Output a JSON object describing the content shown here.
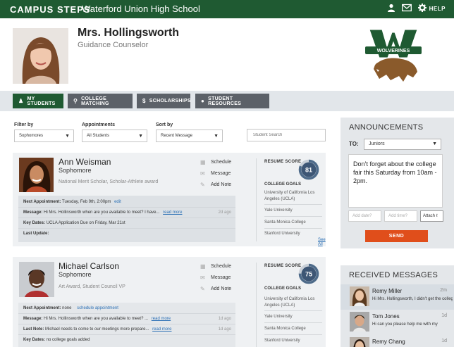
{
  "header": {
    "brand": "CAMPUS STEPS",
    "school": "Waterford Union High School",
    "help": "HELP"
  },
  "profile": {
    "name": "Mrs. Hollingsworth",
    "role": "Guidance Counselor"
  },
  "logo": {
    "text": "WOLVERINES"
  },
  "tabs": [
    {
      "label": "MY STUDENTS",
      "icon": "students-icon"
    },
    {
      "label": "COLLEGE MATCHING",
      "icon": "search-icon"
    },
    {
      "label": "SCHOLARSHIPS",
      "icon": "dollar-icon"
    },
    {
      "label": "STUDENT RESOURCES",
      "icon": "apple-icon"
    }
  ],
  "filters": {
    "filter_by": {
      "label": "Filter by",
      "value": "Sophomores"
    },
    "appointments": {
      "label": "Appointments",
      "value": "All Students"
    },
    "sort_by": {
      "label": "Sort by",
      "value": "Recent Message"
    },
    "search_placeholder": "Student Search"
  },
  "students": [
    {
      "name": "Ann Weisman",
      "grade": "Sophomore",
      "awards": "National Merit Scholar, Scholar-Athlete award",
      "actions": [
        "Schedule",
        "Message",
        "Add Note"
      ],
      "resume_label": "RESUME SCORE",
      "score": "81",
      "score_fraction": 0.81,
      "goals_label": "COLLEGE GOALS",
      "goals": [
        "University of California Los Angeles (UCLA)",
        "Yale University",
        "Santa Monica College",
        "Stanford University"
      ],
      "see_all": "See All",
      "next_appt_label": "Next Appointment:",
      "next_appt": "Tuesday, Feb 9th, 2:00pm",
      "next_appt_link": "edit",
      "message_label": "Message:",
      "message": "Hi Mrs. Hollinsworth when are you available to meet? I have...",
      "message_link": "read more",
      "message_ago": "2d ago",
      "key_dates_label": "Key Dates:",
      "key_dates": "UCLA Application Due on Friday, Mar 21st",
      "last_update_label": "Last Update:"
    },
    {
      "name": "Michael Carlson",
      "grade": "Sophomore",
      "awards": "Art Award, Student Council VP",
      "actions": [
        "Schedule",
        "Message",
        "Add Note"
      ],
      "resume_label": "RESUME SCORE",
      "score": "75",
      "score_fraction": 0.75,
      "goals_label": "COLLEGE GOALS",
      "goals": [
        "University of California Los Angeles (UCLA)",
        "Yale University",
        "Santa Monica College",
        "Stanford University"
      ],
      "next_appt_label": "Next Appointment:",
      "next_appt": "none",
      "next_appt_link": "schedule appointment",
      "message_label": "Message:",
      "message": "Hi Mrs. Hollinsworth when are you available to meet? ...",
      "message_link": "read more",
      "message_ago": "1d ago",
      "last_note_label": "Last Note:",
      "last_note": "Michael needs to come to our meetings more prepare...",
      "last_note_link": "read more",
      "last_note_ago": "1d ago",
      "key_dates_label": "Key Dates:",
      "key_dates": "no college goals added"
    }
  ],
  "announcements": {
    "title": "ANNOUNCEMENTS",
    "to_label": "TO:",
    "to_value": "Juniors",
    "message": "Don’t forget about the college fair this Saturday from 10am - 2pm.",
    "date_placeholder": "Add date?",
    "time_placeholder": "Add time?",
    "attach": "Attach",
    "send": "SEND"
  },
  "received": {
    "title": "RECEIVED MESSAGES",
    "messages": [
      {
        "name": "Remy Miller",
        "time": "2m",
        "text": "Hi Mrs. Hollingsworth, I didn't get the college handout the other d..."
      },
      {
        "name": "Tom Jones",
        "time": "1d",
        "text": "Hi can you please help me with my"
      },
      {
        "name": "Remy Chang",
        "time": "1d",
        "text": ""
      }
    ]
  },
  "colors": {
    "brand_green": "#1f5a32",
    "send_orange": "#e04e1b",
    "link_blue": "#2a6fb5"
  }
}
